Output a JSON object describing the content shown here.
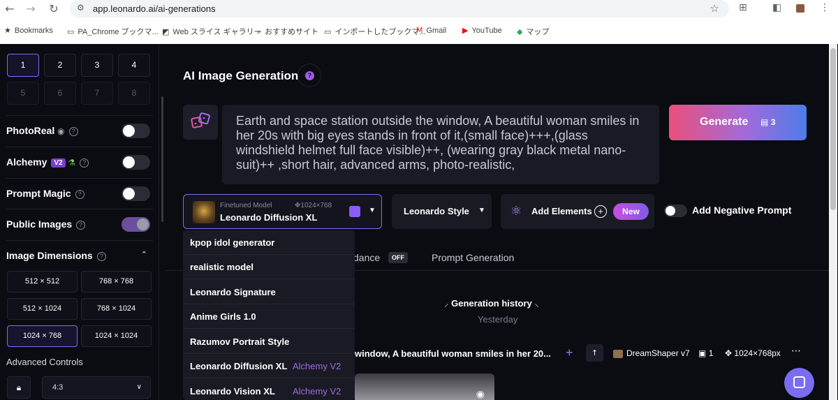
{
  "browser": {
    "url": "app.leonardo.ai/ai-generations",
    "bookmarks": [
      "Bookmarks",
      "PA_Chrome ブックマ...",
      "Web スライス ギャラリー",
      "おすすめサイト",
      "インポートしたブックマ...",
      "Gmail",
      "YouTube",
      "マップ"
    ]
  },
  "sidebar": {
    "image_counts": [
      "1",
      "2",
      "3",
      "4",
      "5",
      "6",
      "7",
      "8"
    ],
    "toggles": {
      "photoreal": "PhotoReal",
      "alchemy": "Alchemy",
      "alchemy_badge": "V2",
      "prompt_magic": "Prompt Magic",
      "public_images": "Public Images"
    },
    "image_dimensions_label": "Image Dimensions",
    "dimensions": [
      "512 × 512",
      "768 × 768",
      "512 × 1024",
      "768 × 1024",
      "1024 × 768",
      "1024 × 1024"
    ],
    "advanced_controls": "Advanced Controls",
    "aspect_ratio": "4:3"
  },
  "main": {
    "title": "AI Image Generation",
    "prompt": "Earth and space station outside the window, A beautiful woman smiles in her 20s with big eyes stands in front of it,(small face)+++,(glass windshield helmet full face visible)++, (wearing gray black metal nano-suit)++ ,short hair, advanced arms, photo-realistic,",
    "generate_label": "Generate",
    "generate_cost": "3",
    "model": {
      "sub": "Finetuned Model",
      "resolution": "1024×768",
      "name": "Leonardo Diffusion XL"
    },
    "style": "Leonardo Style",
    "add_elements": "Add Elements",
    "new_badge": "New",
    "negative_prompt": "Add Negative Prompt",
    "tabs": {
      "guidance_partial": "dance",
      "guidance_state": "OFF",
      "prompt_generation": "Prompt Generation"
    },
    "history": {
      "title": "Generation history",
      "date": "Yesterday",
      "prompt_partial": "window, A beautiful woman smiles in her 20...",
      "model": "DreamShaper v7",
      "count": "1",
      "resolution": "1024×768px"
    }
  },
  "dropdown": {
    "items": [
      {
        "label": "kpop idol generator",
        "tag": ""
      },
      {
        "label": "realistic model",
        "tag": ""
      },
      {
        "label": "Leonardo Signature",
        "tag": ""
      },
      {
        "label": "Anime Girls 1.0",
        "tag": ""
      },
      {
        "label": "Razumov Portrait Style",
        "tag": ""
      },
      {
        "label": "Leonardo Diffusion XL",
        "tag": "Alchemy V2"
      },
      {
        "label": "Leonardo Vision XL",
        "tag": "Alchemy V2"
      }
    ]
  },
  "colors": {
    "accent": "#7b6cf5",
    "background": "#0b0b12",
    "alchemy_tag": "#9b6be0"
  }
}
